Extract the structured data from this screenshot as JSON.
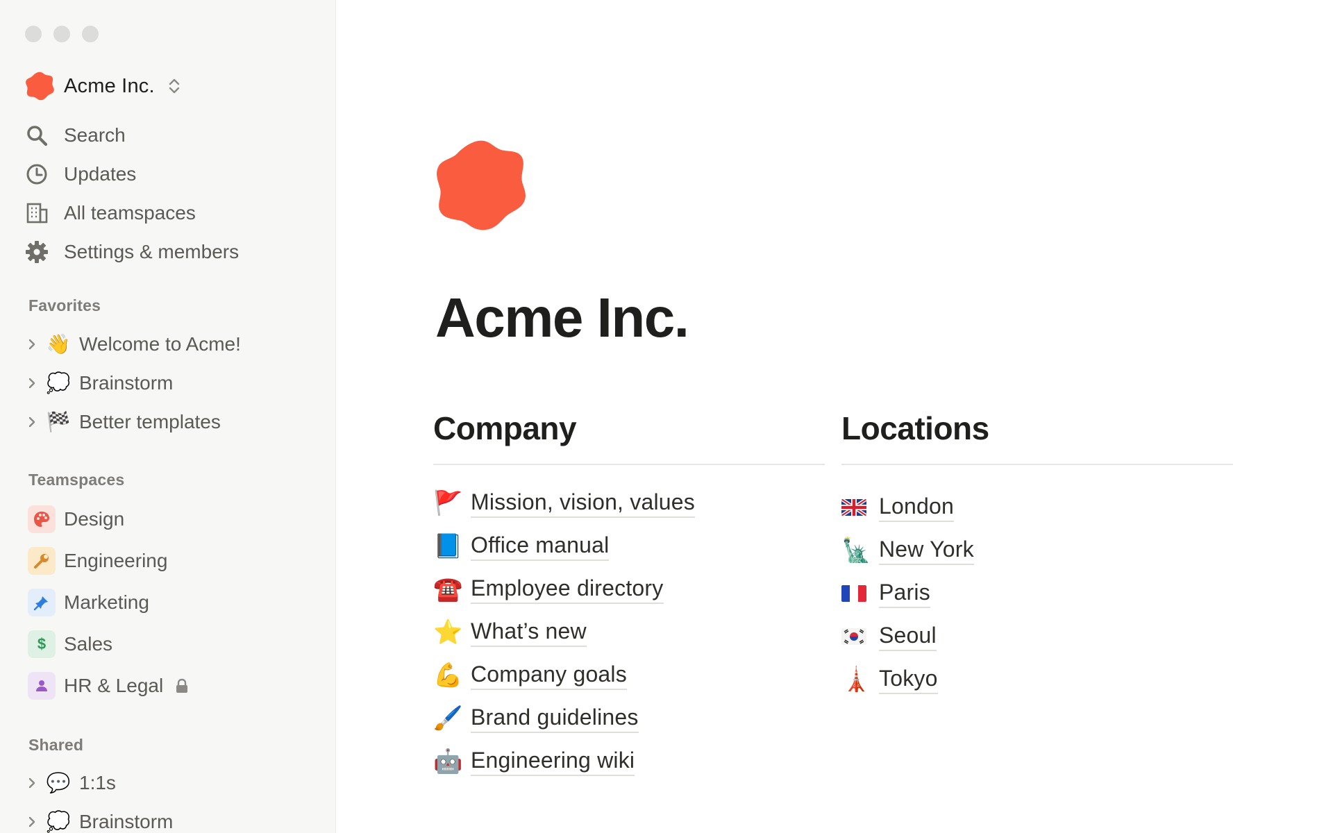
{
  "workspace": {
    "name": "Acme Inc.",
    "brand_color": "#fa5c40"
  },
  "nav": {
    "search": "Search",
    "updates": "Updates",
    "teamspaces": "All teamspaces",
    "settings": "Settings & members"
  },
  "favorites": {
    "label": "Favorites",
    "items": [
      {
        "emoji": "👋",
        "label": "Welcome to Acme!"
      },
      {
        "emoji": "💭",
        "label": "Brainstorm"
      },
      {
        "emoji": "🏁",
        "label": "Better templates"
      }
    ]
  },
  "teamspaces": {
    "label": "Teamspaces",
    "items": [
      {
        "label": "Design",
        "icon": "palette-icon"
      },
      {
        "label": "Engineering",
        "icon": "wrench-icon"
      },
      {
        "label": "Marketing",
        "icon": "pin-icon"
      },
      {
        "label": "Sales",
        "icon": "dollar-icon",
        "glyph": "$"
      },
      {
        "label": "HR & Legal",
        "icon": "person-icon",
        "private": true
      }
    ]
  },
  "shared": {
    "label": "Shared",
    "items": [
      {
        "emoji": "💬",
        "label": "1:1s"
      },
      {
        "emoji": "💭",
        "label": "Brainstorm"
      }
    ]
  },
  "page": {
    "title": "Acme Inc.",
    "company": {
      "heading": "Company",
      "links": [
        {
          "emoji": "🚩",
          "label": "Mission, vision, values"
        },
        {
          "emoji": "📘",
          "label": "Office manual"
        },
        {
          "emoji": "☎️",
          "label": "Employee directory"
        },
        {
          "emoji": "⭐",
          "label": "What’s new"
        },
        {
          "emoji": "💪",
          "label": "Company goals"
        },
        {
          "emoji": "🖌️",
          "label": "Brand guidelines"
        },
        {
          "emoji": "🤖",
          "label": "Engineering wiki"
        }
      ]
    },
    "locations": {
      "heading": "Locations",
      "links": [
        {
          "flag": "uk-flag",
          "label": "London"
        },
        {
          "emoji": "🗽",
          "label": "New York"
        },
        {
          "flag": "france-flag",
          "label": "Paris"
        },
        {
          "flag": "korea-flag",
          "label": "Seoul"
        },
        {
          "emoji": "🗼",
          "label": "Tokyo"
        }
      ]
    }
  }
}
